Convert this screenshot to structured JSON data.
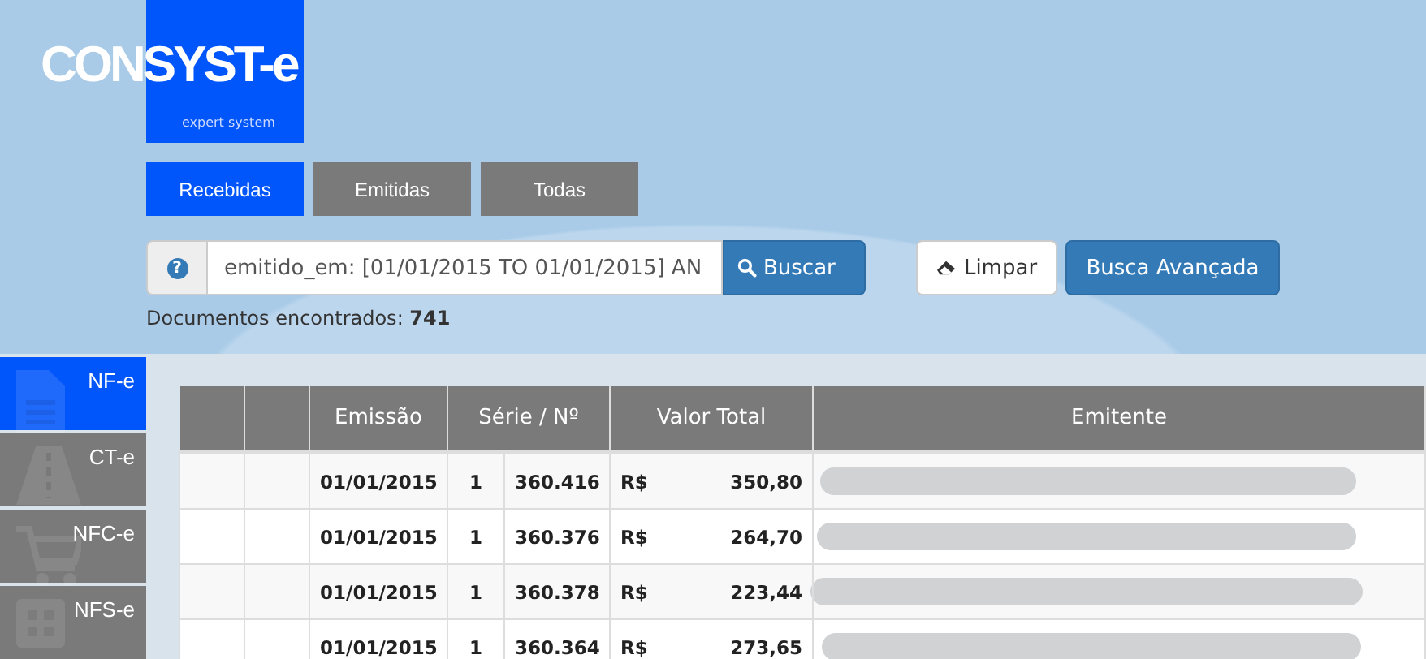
{
  "logo": {
    "name": "CONSYST-e",
    "tagline": "expert system"
  },
  "tabs": [
    {
      "label": "Recebidas",
      "selected": true
    },
    {
      "label": "Emitidas",
      "selected": false
    },
    {
      "label": "Todas",
      "selected": false
    }
  ],
  "search": {
    "help": "?",
    "value": "emitido_em: [01/01/2015 TO 01/01/2015] AN",
    "search_button": "Buscar",
    "clear_button": "Limpar",
    "advanced_button": "Busca Avançada"
  },
  "result_count": {
    "label": "Documentos encontrados:",
    "value": "741"
  },
  "sidebar": {
    "items": [
      {
        "label": "NF-e",
        "kind": "document",
        "selected": true
      },
      {
        "label": "CT-e",
        "kind": "road",
        "selected": false
      },
      {
        "label": "NFC-e",
        "kind": "cart",
        "selected": false
      },
      {
        "label": "NFS-e",
        "kind": "grid",
        "selected": false
      }
    ]
  },
  "table": {
    "columns": [
      "Emissão",
      "Série / Nº",
      "Valor Total",
      "Emitente"
    ],
    "rows": [
      {
        "emissao": "01/01/2015",
        "serie": "1",
        "numero": "360.416",
        "moeda": "R$",
        "valor": "350,80"
      },
      {
        "emissao": "01/01/2015",
        "serie": "1",
        "numero": "360.376",
        "moeda": "R$",
        "valor": "264,70"
      },
      {
        "emissao": "01/01/2015",
        "serie": "1",
        "numero": "360.378",
        "moeda": "R$",
        "valor": "223,44"
      },
      {
        "emissao": "01/01/2015",
        "serie": "1",
        "numero": "360.364",
        "moeda": "R$",
        "valor": "273,65"
      }
    ]
  }
}
